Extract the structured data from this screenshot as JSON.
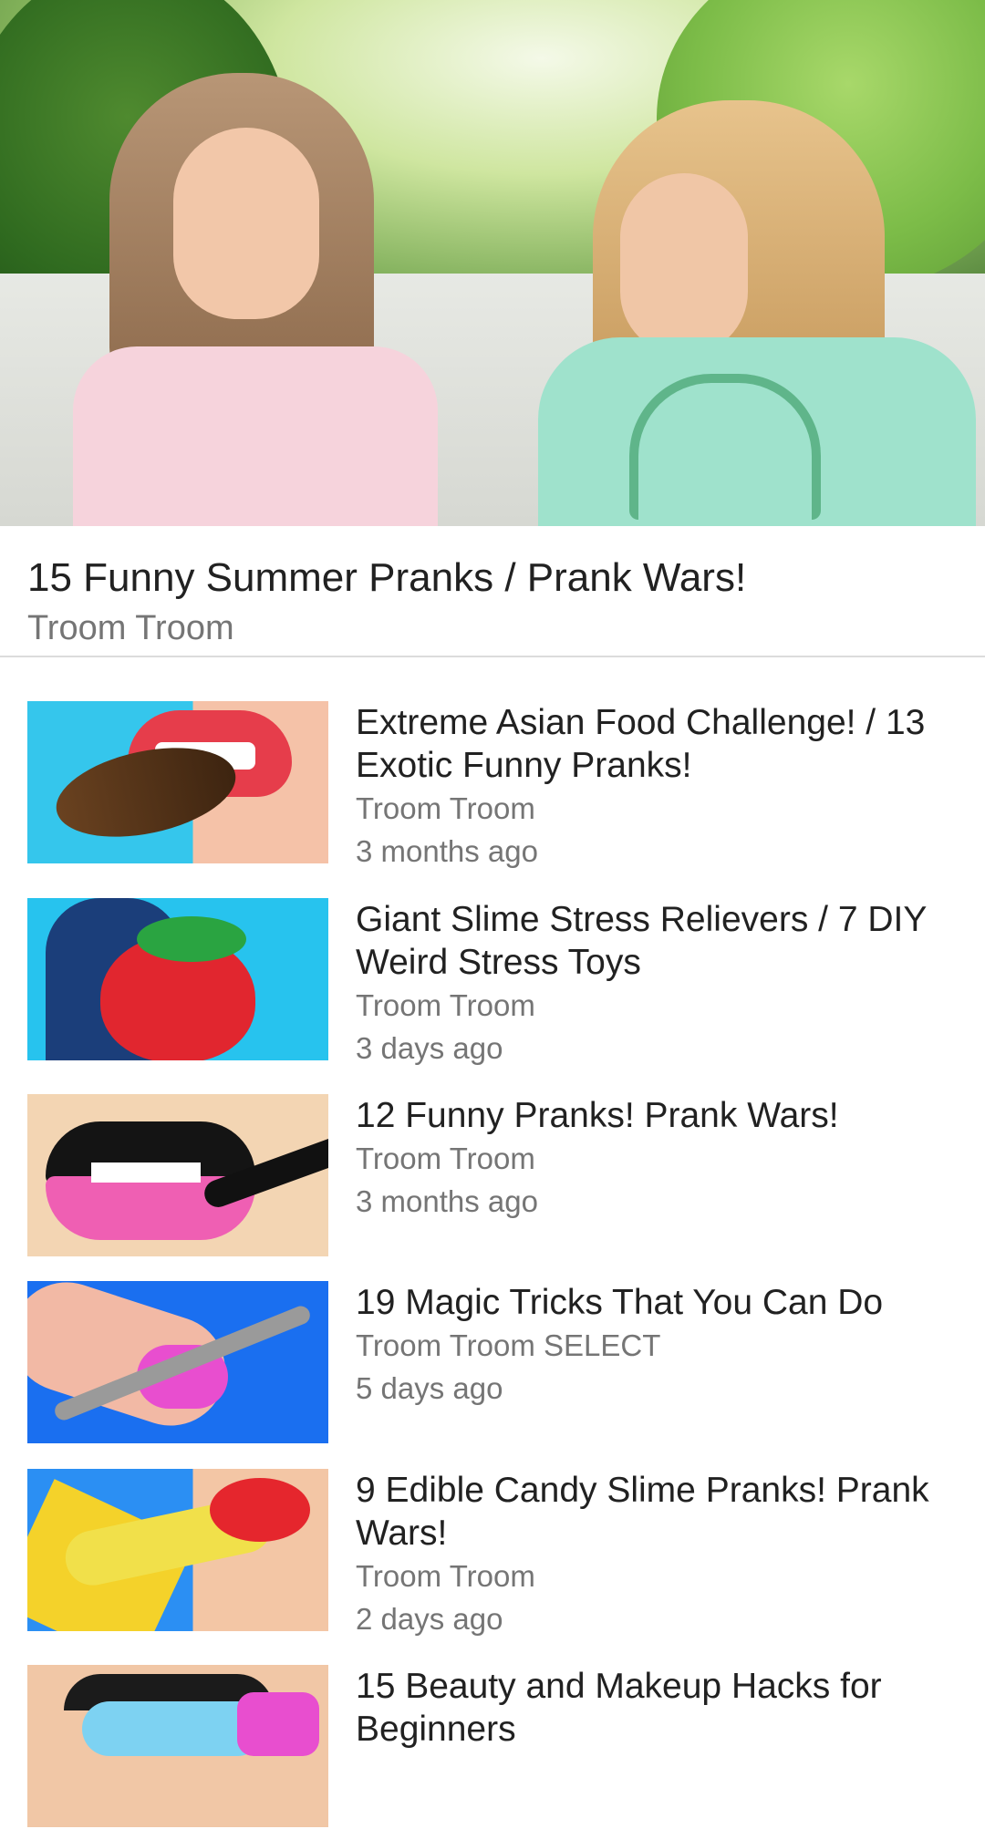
{
  "now_playing": {
    "title": "15 Funny Summer Pranks / Prank Wars!",
    "channel": "Troom Troom"
  },
  "videos": [
    {
      "title": "Extreme Asian Food Challenge! / 13 Exotic Funny Pranks!",
      "channel": "Troom Troom",
      "age": "3 months ago"
    },
    {
      "title": "Giant Slime Stress Relievers / 7 DIY Weird Stress Toys",
      "channel": "Troom Troom",
      "age": "3 days ago"
    },
    {
      "title": "12 Funny Pranks! Prank Wars!",
      "channel": "Troom Troom",
      "age": "3 months ago"
    },
    {
      "title": "19 Magic Tricks That You Can Do",
      "channel": "Troom Troom SELECT",
      "age": "5 days ago"
    },
    {
      "title": "9 Edible Candy Slime Pranks! Prank Wars!",
      "channel": "Troom Troom",
      "age": "2 days ago"
    },
    {
      "title": "15 Beauty and Makeup Hacks for Beginners",
      "channel": "",
      "age": ""
    }
  ]
}
